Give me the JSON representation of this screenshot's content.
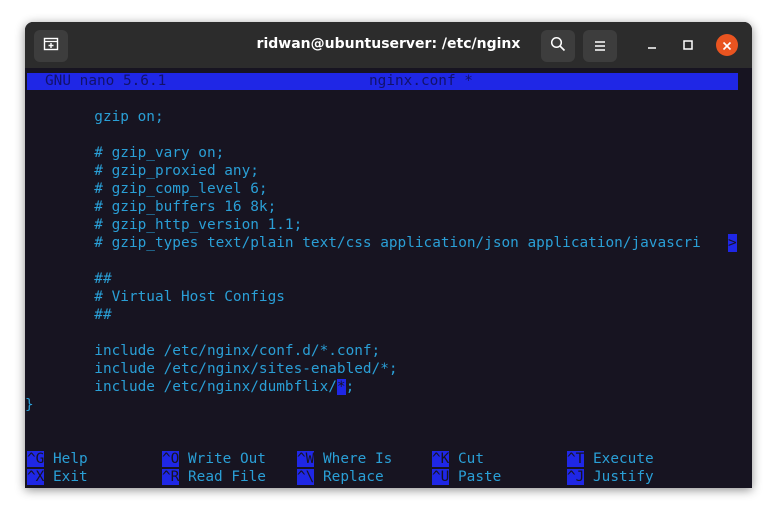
{
  "window": {
    "title": "ridwan@ubuntuserver: /etc/nginx"
  },
  "nano": {
    "version_label": "GNU nano 5.6.1",
    "filename_label": "nginx.conf *"
  },
  "editor": {
    "lines": [
      "        gzip on;",
      "",
      "        # gzip_vary on;",
      "        # gzip_proxied any;",
      "        # gzip_comp_level 6;",
      "        # gzip_buffers 16 8k;",
      "        # gzip_http_version 1.1;",
      "        # gzip_types text/plain text/css application/json application/javascri",
      "",
      "        ##",
      "        # Virtual Host Configs",
      "        ##",
      "",
      "        include /etc/nginx/conf.d/*.conf;",
      "        include /etc/nginx/sites-enabled/*;",
      "        include /etc/nginx/dumbflix/",
      "}"
    ],
    "truncation_marker": ">",
    "cursor_char": "*",
    "cursor_after": ";"
  },
  "shortcuts": {
    "row1": [
      {
        "key": "^G",
        "label": "Help"
      },
      {
        "key": "^O",
        "label": "Write Out"
      },
      {
        "key": "^W",
        "label": "Where Is"
      },
      {
        "key": "^K",
        "label": "Cut"
      },
      {
        "key": "^T",
        "label": "Execute"
      }
    ],
    "row2": [
      {
        "key": "^X",
        "label": "Exit"
      },
      {
        "key": "^R",
        "label": "Read File"
      },
      {
        "key": "^\\",
        "label": "Replace"
      },
      {
        "key": "^U",
        "label": "Paste"
      },
      {
        "key": "^J",
        "label": "Justify"
      }
    ]
  },
  "icons": {
    "new_tab": "new-tab-icon",
    "search": "search-icon",
    "menu": "hamburger-menu-icon",
    "minimize": "minimize-icon",
    "maximize": "maximize-icon",
    "close": "close-icon"
  },
  "colors": {
    "accent_blue": "#1f27e6",
    "text_cyan": "#2a9fd6",
    "terminal_bg": "#171421",
    "close_orange": "#e95420"
  }
}
